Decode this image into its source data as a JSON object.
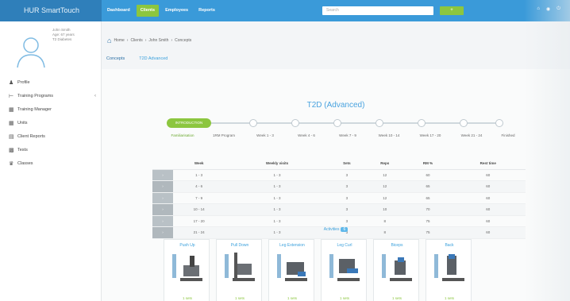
{
  "app": {
    "brand": "HUR SmartTouch"
  },
  "nav": [
    {
      "label": "Dashboard",
      "active": false
    },
    {
      "label": "Clients",
      "active": true
    },
    {
      "label": "Employees",
      "active": false
    },
    {
      "label": "Reports",
      "active": false
    }
  ],
  "search": {
    "placeholder": "Search",
    "button_label": "+"
  },
  "profile": {
    "lines": [
      "John Smith",
      "Age: 67 years",
      "T2 Diabetes"
    ]
  },
  "sidebar": {
    "items": [
      {
        "label": "Profile",
        "icon": "user-icon",
        "caret": false
      },
      {
        "label": "Training Programs",
        "icon": "dumbbell-icon",
        "caret": true
      },
      {
        "label": "Training Manager",
        "icon": "calendar-icon",
        "caret": false
      },
      {
        "label": "Units",
        "icon": "grid-icon",
        "caret": false
      },
      {
        "label": "Client Reports",
        "icon": "report-icon",
        "caret": false
      },
      {
        "label": "Tests",
        "icon": "chart-icon",
        "caret": false
      },
      {
        "label": "Classes",
        "icon": "group-icon",
        "caret": false
      }
    ]
  },
  "breadcrumb": [
    "Home",
    "Clients",
    "John Smith",
    "Concepts"
  ],
  "subtabs": [
    {
      "label": "Concepts"
    },
    {
      "label": "T2D Advanced"
    }
  ],
  "program": {
    "title": "T2D (Advanced)",
    "start_label": "INTRODUCTION",
    "steps": [
      "Familiarisation",
      "1RM Program",
      "Week 1 - 3",
      "Week 4 - 6",
      "Week 7 - 9",
      "Week 10 - 14",
      "Week 17 - 20",
      "Week 21 - 24",
      "Finished"
    ]
  },
  "table": {
    "headers": [
      "Week",
      "Weekly visits",
      "Sets",
      "Reps",
      "RM %",
      "Rest time"
    ],
    "rows": [
      [
        "1 - 3",
        "1 - 3",
        "3",
        "12",
        "60",
        "60"
      ],
      [
        "4 - 6",
        "1 - 3",
        "3",
        "12",
        "65",
        "60"
      ],
      [
        "7 - 9",
        "1 - 3",
        "3",
        "12",
        "65",
        "60"
      ],
      [
        "10 - 14",
        "1 - 3",
        "3",
        "10",
        "70",
        "60"
      ],
      [
        "17 - 20",
        "1 - 3",
        "3",
        "8",
        "75",
        "60"
      ],
      [
        "21 - 24",
        "1 - 3",
        "3",
        "8",
        "75",
        "60"
      ]
    ]
  },
  "activities": {
    "label": "Activities",
    "count": "6",
    "cards": [
      {
        "title": "Push Up",
        "sub": "1 sets"
      },
      {
        "title": "Pull Down",
        "sub": "1 sets"
      },
      {
        "title": "Leg Extension",
        "sub": "1 sets"
      },
      {
        "title": "Leg Curl",
        "sub": "1 sets"
      },
      {
        "title": "Biceps",
        "sub": "1 sets"
      },
      {
        "title": "Back",
        "sub": "1 sets"
      }
    ]
  },
  "colors": {
    "topbar": "#3a9ad9",
    "brand": "#2f7fba",
    "accent_green": "#8cc63f",
    "link_blue": "#3aa0dc"
  }
}
